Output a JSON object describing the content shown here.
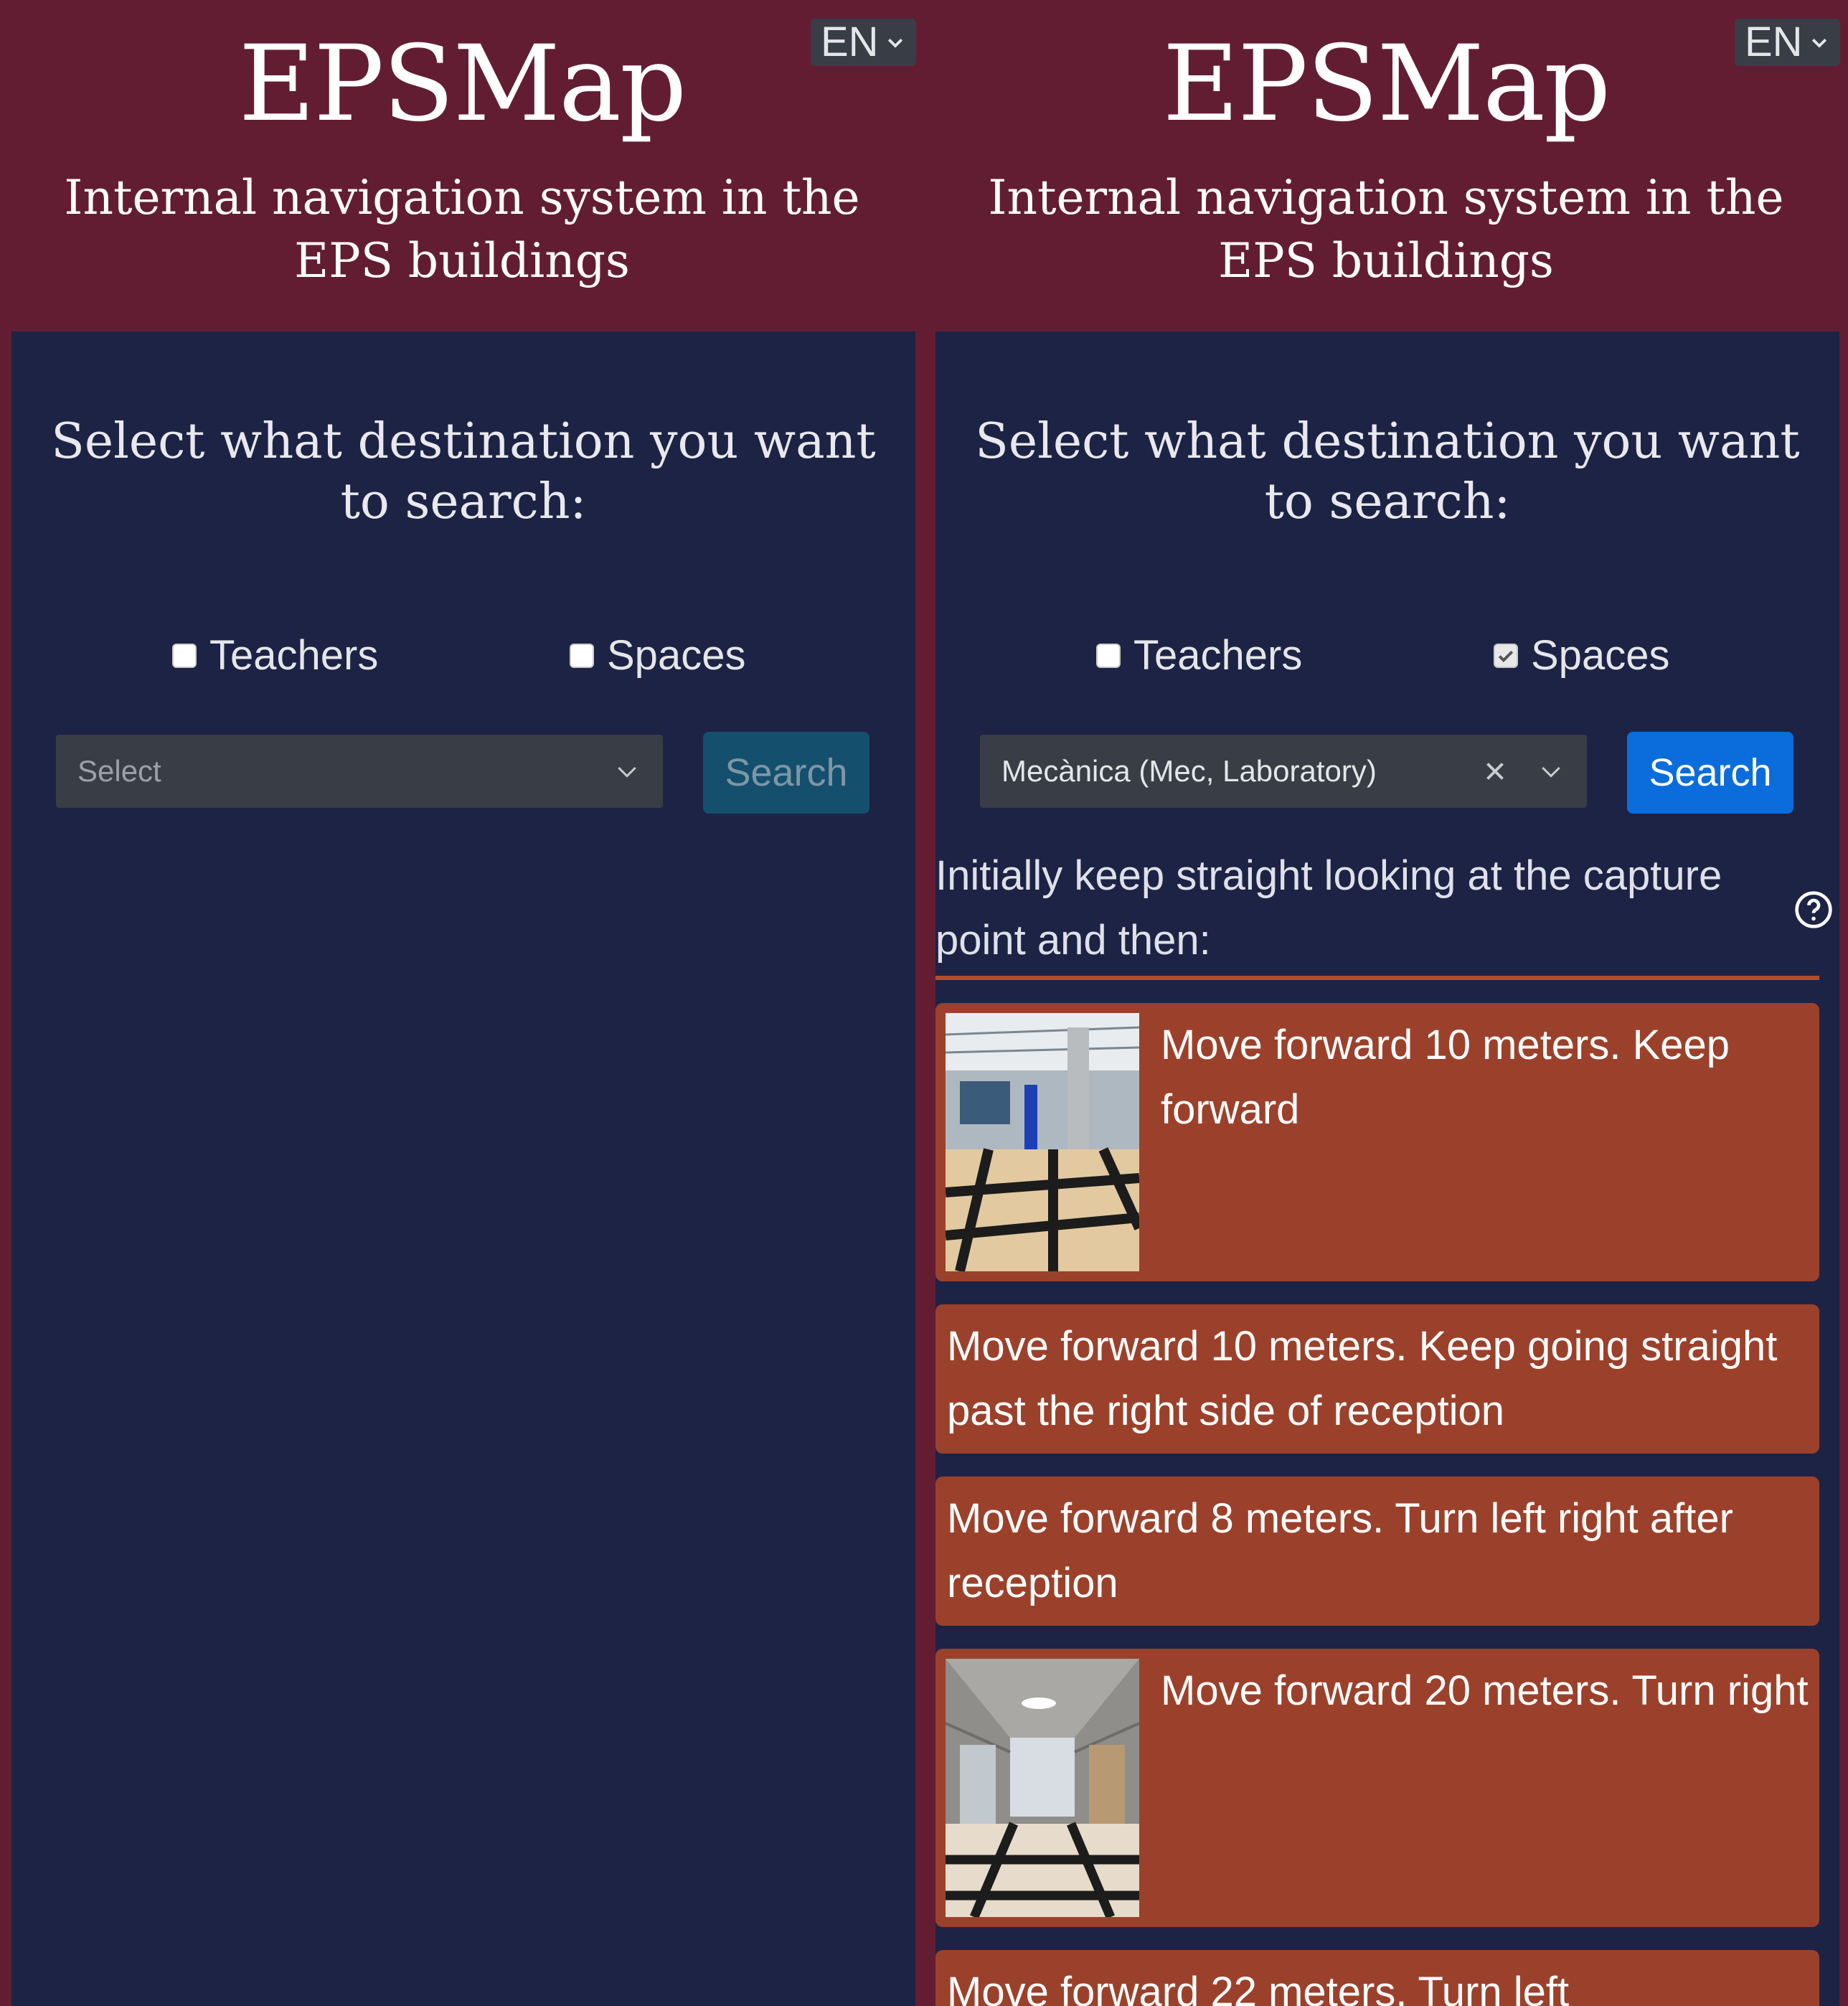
{
  "header": {
    "title": "EPSMap",
    "subtitle": "Internal navigation system in the EPS buildings",
    "language": "EN"
  },
  "form": {
    "prompt": "Select what destination you want to search:",
    "teachers_label": "Teachers",
    "spaces_label": "Spaces",
    "search_label": "Search"
  },
  "left_screen": {
    "teachers_checked": false,
    "spaces_checked": false,
    "select_placeholder": "Select",
    "search_enabled": false
  },
  "right_screen": {
    "teachers_checked": false,
    "spaces_checked": true,
    "selected_value": "Mecànica (Mec, Laboratory)",
    "search_enabled": true,
    "intro": "Initially keep straight looking at the capture point and then:",
    "steps": [
      {
        "text": "Move forward 10 meters. Keep forward",
        "has_photo": true
      },
      {
        "text": "Move forward 10 meters. Keep going straight past the right side of reception",
        "has_photo": false
      },
      {
        "text": "Move forward 8 meters. Turn left right after reception",
        "has_photo": false
      },
      {
        "text": "Move forward 20 meters. Turn right",
        "has_photo": true
      },
      {
        "text": "Move forward 22 meters. Turn left",
        "has_photo": false
      }
    ]
  },
  "colors": {
    "header_bg": "#631d33",
    "panel_bg": "#1d2344",
    "step_bg": "#9b412b",
    "search_active": "#0b6ddc",
    "search_disabled": "#14506e"
  },
  "icons": [
    "chevron-down-icon",
    "clear-icon",
    "help-circle-icon",
    "checkmark-icon"
  ]
}
